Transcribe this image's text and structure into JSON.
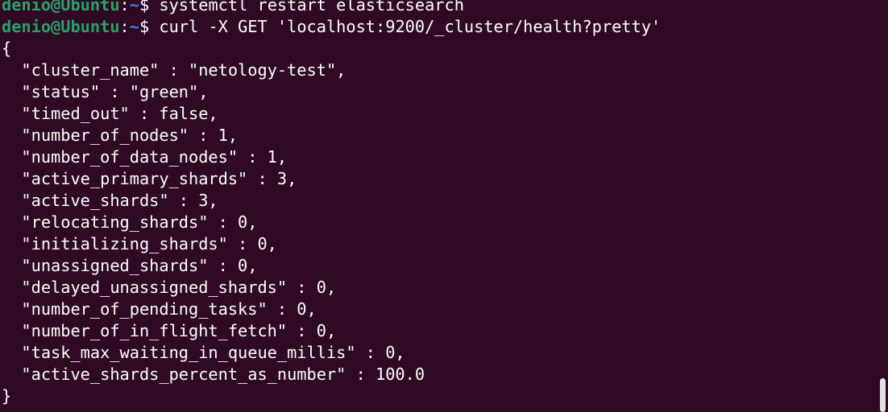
{
  "terminal": {
    "prompts": [
      {
        "user_host": "denio@Ubuntu",
        "sep": ":",
        "cwd": "~",
        "symbol": "$ ",
        "command": "systemctl restart elasticsearch"
      },
      {
        "user_host": "denio@Ubuntu",
        "sep": ":",
        "cwd": "~",
        "symbol": "$ ",
        "command": "curl -X GET 'localhost:9200/_cluster/health?pretty'"
      }
    ],
    "output_lines": [
      "{",
      "  \"cluster_name\" : \"netology-test\",",
      "  \"status\" : \"green\",",
      "  \"timed_out\" : false,",
      "  \"number_of_nodes\" : 1,",
      "  \"number_of_data_nodes\" : 1,",
      "  \"active_primary_shards\" : 3,",
      "  \"active_shards\" : 3,",
      "  \"relocating_shards\" : 0,",
      "  \"initializing_shards\" : 0,",
      "  \"unassigned_shards\" : 0,",
      "  \"delayed_unassigned_shards\" : 0,",
      "  \"number_of_pending_tasks\" : 0,",
      "  \"number_of_in_flight_fetch\" : 0,",
      "  \"task_max_waiting_in_queue_millis\" : 0,",
      "  \"active_shards_percent_as_number\" : 100.0",
      "}"
    ]
  },
  "colors": {
    "background": "#300a24",
    "text": "#ffffff",
    "prompt_user_host": "#26a269",
    "prompt_cwd": "#3c82d6",
    "scrollbar_thumb": "#e3e3e3"
  }
}
